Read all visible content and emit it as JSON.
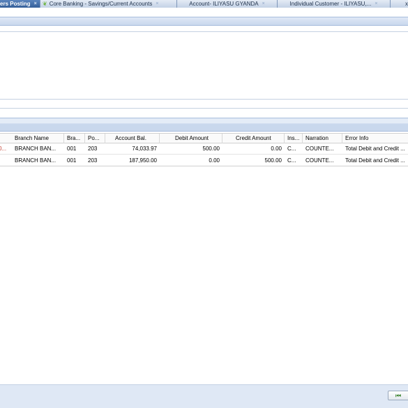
{
  "tabs": [
    {
      "label": "ers Posting",
      "close": "×",
      "active": true
    },
    {
      "label": "Core Banking - Savings/Current Accounts",
      "close": "×",
      "active": false
    },
    {
      "label": "Account- ILIYASU GYANDA",
      "close": "×",
      "active": false
    },
    {
      "label": "Individual Customer - ILIYASU,...",
      "close": "×",
      "active": false
    },
    {
      "label": "x",
      "close": "",
      "active": false
    }
  ],
  "grid": {
    "columns": [
      "Branch Name",
      "Bra...",
      "Po...",
      "Account Bal.",
      "Debit Amount",
      "Credit Amount",
      "Ins...",
      "Narration",
      "Error Info"
    ],
    "rows": [
      {
        "lead": "0...",
        "branch_name": "BRANCH BAN...",
        "branch": "001",
        "post": "203",
        "account_bal": "74,033.97",
        "debit": "500.00",
        "credit": "0.00",
        "ins": "C...",
        "narration": "COUNTE...",
        "error": "Total Debit and Credit ..."
      },
      {
        "lead": "",
        "branch_name": "BRANCH BAN...",
        "branch": "001",
        "post": "203",
        "account_bal": "187,950.00",
        "debit": "0.00",
        "credit": "500.00",
        "ins": "C...",
        "narration": "COUNTE...",
        "error": "Total Debit and Credit ..."
      }
    ]
  },
  "footer": {
    "first_page_icon": "first-page-icon"
  }
}
